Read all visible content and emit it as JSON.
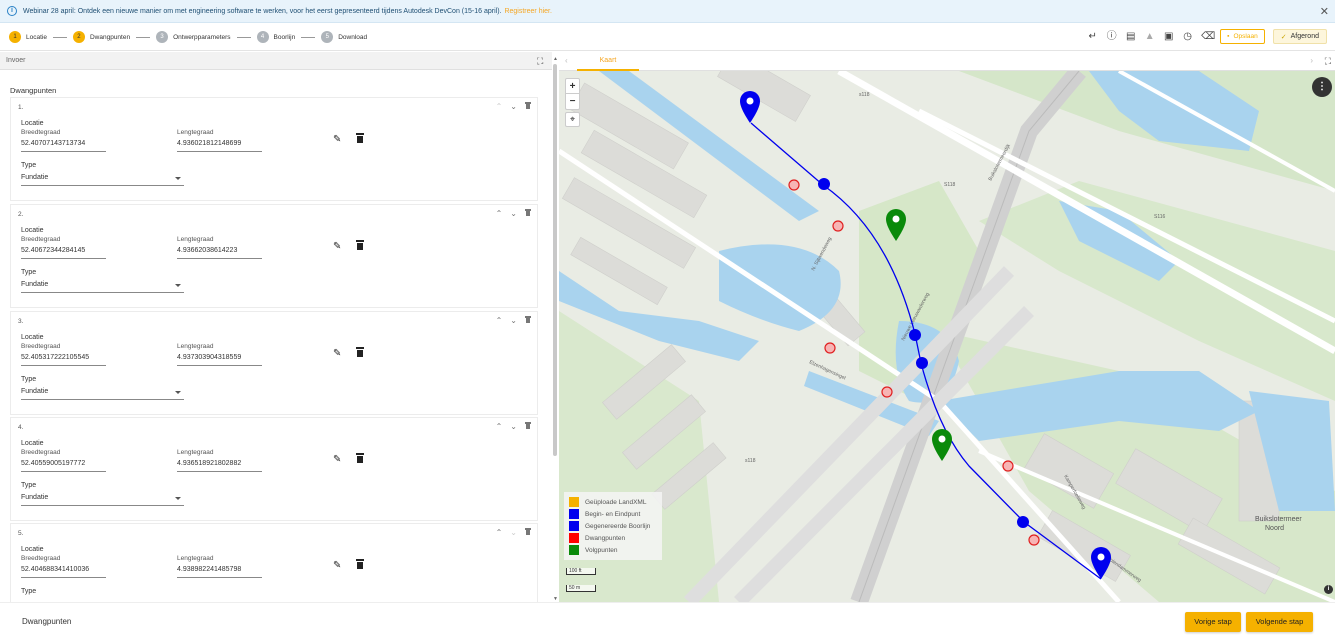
{
  "banner": {
    "text": "Webinar 28 april: Ontdek een nieuwe manier om met engineering software te werken, voor het eerst gepresenteerd tijdens Autodesk DevCon (15-16 april).",
    "link": "Registreer hier."
  },
  "steps": [
    {
      "num": "1",
      "label": "Locatie"
    },
    {
      "num": "2",
      "label": "Dwangpunten"
    },
    {
      "num": "3",
      "label": "Ontwerpparameters"
    },
    {
      "num": "4",
      "label": "Boorlijn"
    },
    {
      "num": "5",
      "label": "Download"
    }
  ],
  "toolbar": {
    "save_label": "Opslaan",
    "done_label": "Afgerond"
  },
  "left_panel": {
    "header": "Invoer",
    "section_title": "Dwangpunten",
    "field_location": "Locatie",
    "field_lat": "Breedtegraad",
    "field_lon": "Lengtegraad",
    "field_type": "Type",
    "points": [
      {
        "index": "1.",
        "lat": "52.40707143713734",
        "lon": "4.936021812148699",
        "type": "Fundatie"
      },
      {
        "index": "2.",
        "lat": "52.40672344284145",
        "lon": "4.93662038614223",
        "type": "Fundatie"
      },
      {
        "index": "3.",
        "lat": "52.405317222105545",
        "lon": "4.937303904318559",
        "type": "Fundatie"
      },
      {
        "index": "4.",
        "lat": "52.40559005197772",
        "lon": "4.936518921802882",
        "type": "Fundatie"
      },
      {
        "index": "5.",
        "lat": "52.404688341410036",
        "lon": "4.938982241485798",
        "type": ""
      }
    ]
  },
  "map": {
    "tab": "Kaart",
    "place_label_1": "Buikslotermeer",
    "place_label_2": "Noord",
    "scale_1": "100 ft",
    "scale_2": "50 m",
    "legend": [
      {
        "label": "Geüploade LandXML",
        "color": "#f5b100"
      },
      {
        "label": "Begin- en Eindpunt",
        "color": "#0000ee"
      },
      {
        "label": "Gegenereerde Boorlijn",
        "color": "#0000ee"
      },
      {
        "label": "Dwangpunten",
        "color": "#ff0000"
      },
      {
        "label": "Volgpunten",
        "color": "#0a8a0a"
      }
    ],
    "road_labels": [
      "s118",
      "S118",
      "S116",
      "Nieuwe Leeuwarderweg",
      "Buikslotermeerdijk",
      "N. Sijtwendeweg",
      "Elzenhagensingel",
      "Kamperfoelieweg",
      "Volendammerweg"
    ]
  },
  "footer": {
    "title": "Dwangpunten",
    "prev_label": "Vorige stap",
    "next_label": "Volgende stap"
  },
  "colors": {
    "accent": "#f5b100",
    "route": "#0000ee",
    "constraint": "#ff0000",
    "follow": "#0a8a0a"
  }
}
